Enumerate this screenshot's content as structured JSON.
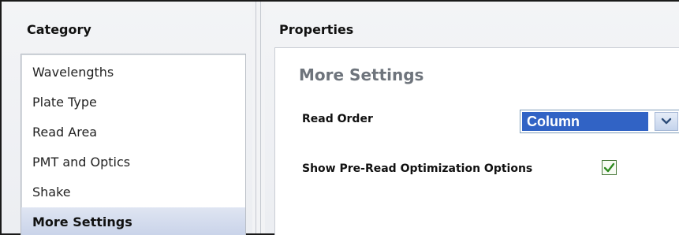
{
  "category_panel": {
    "header": "Category",
    "items": [
      {
        "label": "Wavelengths",
        "selected": false
      },
      {
        "label": "Plate Type",
        "selected": false
      },
      {
        "label": "Read Area",
        "selected": false
      },
      {
        "label": "PMT and Optics",
        "selected": false
      },
      {
        "label": "Shake",
        "selected": false
      },
      {
        "label": "More Settings",
        "selected": true
      }
    ]
  },
  "properties_panel": {
    "header": "Properties",
    "section_title": "More Settings",
    "read_order": {
      "label": "Read Order",
      "value": "Column"
    },
    "pre_read_optimization": {
      "label": "Show Pre-Read Optimization Options",
      "checked": true
    }
  },
  "icons": {
    "dropdown": "chevron-down-icon",
    "checkbox_check": "checkmark-icon"
  },
  "colors": {
    "selection_blue": "#3163c5",
    "section_title_gray": "#6e747c",
    "checkmark_green": "#2e8b1f"
  }
}
